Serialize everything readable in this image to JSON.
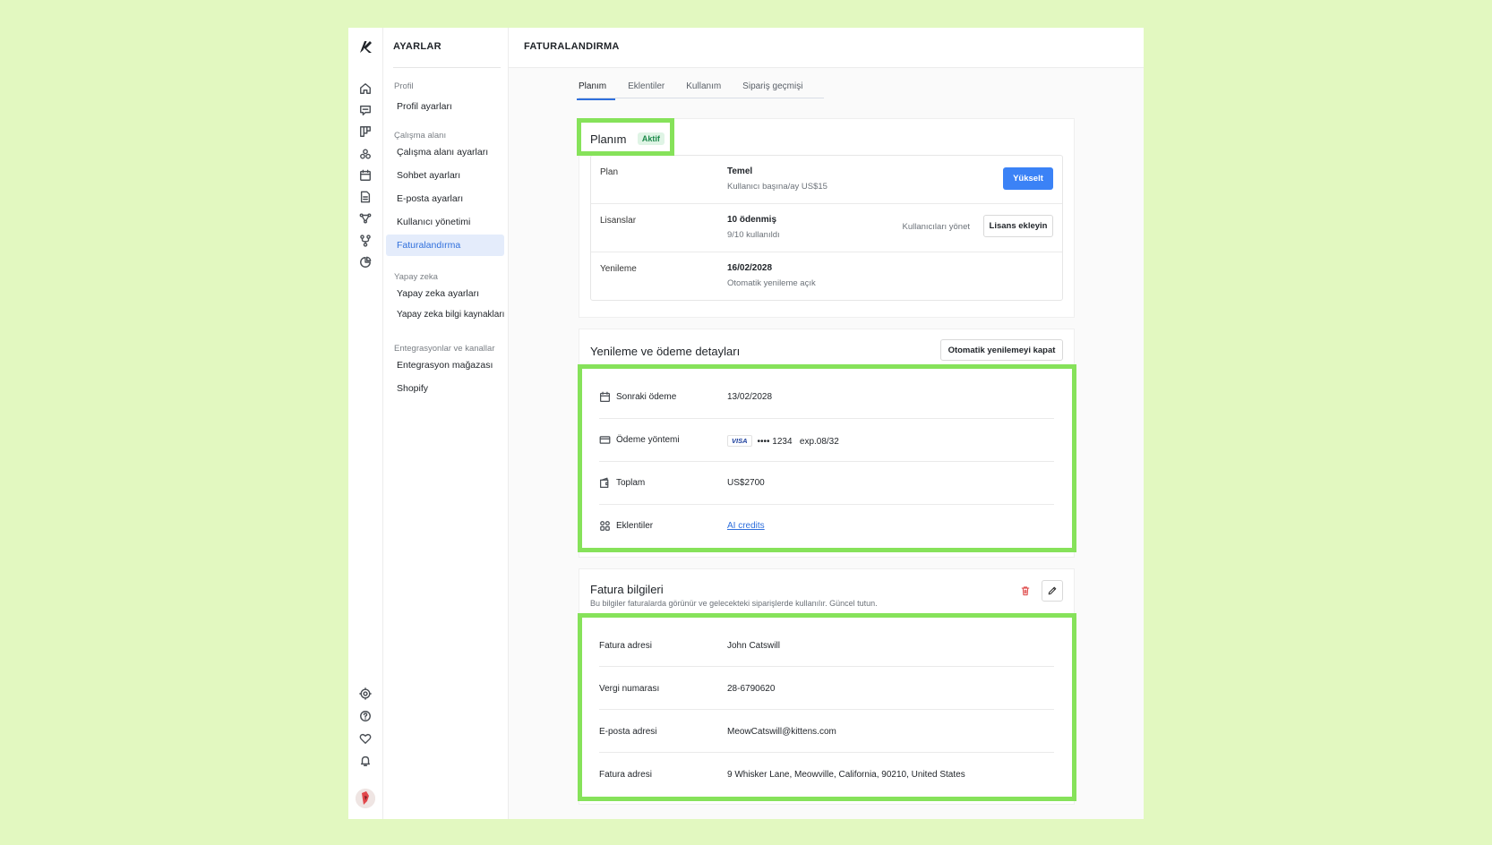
{
  "settings_nav": {
    "title": "AYARLAR",
    "groups": [
      {
        "title": "Profil",
        "items": [
          "Profil ayarları"
        ]
      },
      {
        "title": "Çalışma alanı",
        "items": [
          "Çalışma alanı ayarları",
          "Sohbet ayarları",
          "E-posta ayarları",
          "Kullanıcı yönetimi",
          "Faturalandırma"
        ]
      },
      {
        "title": "Yapay zeka",
        "items": [
          "Yapay zeka ayarları",
          "Yapay zeka bilgi kaynakları"
        ]
      },
      {
        "title": "Entegrasyonlar ve kanallar",
        "items": [
          "Entegrasyon mağazası",
          "Shopify"
        ]
      }
    ],
    "active_item": "Faturalandırma"
  },
  "page_title": "FATURALANDIRMA",
  "tabs": [
    "Planım",
    "Eklentiler",
    "Kullanım",
    "Sipariş geçmişi"
  ],
  "plan_card": {
    "title": "Planım",
    "badge": "Aktif",
    "rows": [
      {
        "label": "Plan",
        "value": "Temel",
        "sub": "Kullanıcı başına/ay US$15"
      },
      {
        "label": "Lisanslar",
        "value": "10 ödenmiş",
        "sub": "9/10 kullanıldı"
      },
      {
        "label": "Yenileme",
        "value": "16/02/2028",
        "sub": "Otomatik yenileme açık"
      }
    ],
    "upgrade_button": "Yükselt",
    "manage_users_link": "Kullanıcıları yönet",
    "add_license_button": "Lisans ekleyin"
  },
  "renewal_card": {
    "title": "Yenileme ve ödeme detayları",
    "disable_auto_renew_button": "Otomatik yenilemeyi kapat",
    "rows": [
      {
        "label": "Sonraki ödeme",
        "value": "13/02/2028"
      },
      {
        "label": "Ödeme yöntemi",
        "card_brand": "VISA",
        "value": "•••• 1234   exp.08/32"
      },
      {
        "label": "Toplam",
        "value": "US$2700"
      },
      {
        "label": "Eklentiler",
        "value": "AI credits"
      }
    ]
  },
  "invoice_card": {
    "title": "Fatura bilgileri",
    "note": "Bu bilgiler faturalarda görünür ve gelecekteki siparişlerde kullanılır. Güncel tutun.",
    "rows": [
      {
        "label": "Fatura adresi",
        "value": "John Catswill"
      },
      {
        "label": "Vergi numarası",
        "value": "28-6790620"
      },
      {
        "label": "E-posta adresi",
        "value": "MeowCatswill@kittens.com"
      },
      {
        "label": "Fatura adresi",
        "value": "9 Whisker Lane, Meowville, California, 90210, United States"
      }
    ]
  },
  "colors": {
    "accent": "#2f6fdc",
    "primary_button": "#3b82f6",
    "badge_green": "#1e8a4c",
    "highlight": "#86e25a",
    "background": "#e2f8c0"
  }
}
